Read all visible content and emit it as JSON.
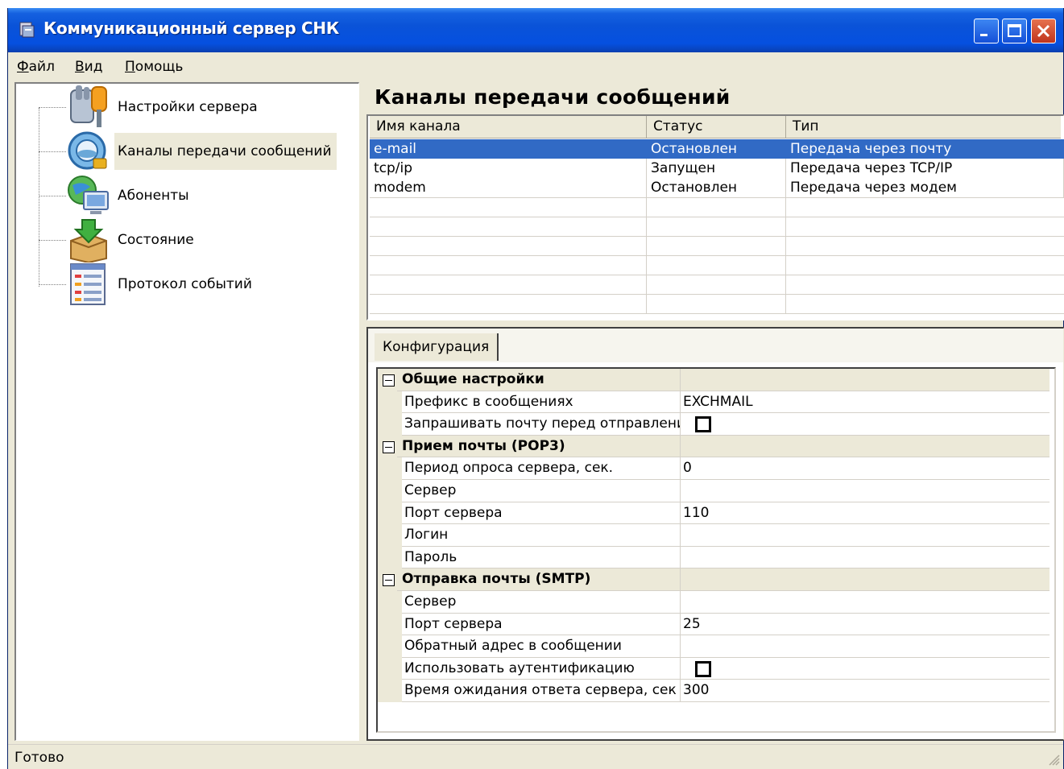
{
  "window": {
    "title": "Коммуникационный сервер СНК"
  },
  "menu": [
    {
      "label_u": "Ф",
      "label_rest": "айл"
    },
    {
      "label_u": "В",
      "label_rest": "ид"
    },
    {
      "label_u": "П",
      "label_rest": "омощь"
    }
  ],
  "tree": {
    "items": [
      {
        "label": "Настройки сервера",
        "icon": "tools-icon"
      },
      {
        "label": "Каналы передачи сообщений",
        "icon": "network-globe-icon"
      },
      {
        "label": "Абоненты",
        "icon": "users-globe-icon"
      },
      {
        "label": "Состояние",
        "icon": "box-arrow-icon"
      },
      {
        "label": "Протокол событий",
        "icon": "list-log-icon"
      }
    ],
    "selected_index": 1
  },
  "channels": {
    "title": "Каналы передачи сообщений",
    "columns": [
      "Имя канала",
      "Статус",
      "Тип"
    ],
    "rows": [
      [
        "e-mail",
        "Остановлен",
        "Передача через почту"
      ],
      [
        "tcp/ip",
        "Запущен",
        "Передача через TCP/IP"
      ],
      [
        "modem",
        "Остановлен",
        "Передача через модем"
      ]
    ],
    "selected_row": 0
  },
  "config": {
    "tab": "Конфигурация",
    "rows": [
      {
        "type": "cat",
        "name": "Общие настройки"
      },
      {
        "type": "prop",
        "name": "Префикс в сообщениях",
        "value": "EXCHMAIL"
      },
      {
        "type": "check",
        "name": "Запрашивать почту перед отправлени",
        "checked": false
      },
      {
        "type": "cat",
        "name": "Прием почты (POP3)"
      },
      {
        "type": "prop",
        "name": "Период опроса сервера, сек.",
        "value": "0"
      },
      {
        "type": "prop",
        "name": "Сервер",
        "value": ""
      },
      {
        "type": "prop",
        "name": "Порт сервера",
        "value": "110"
      },
      {
        "type": "prop",
        "name": "Логин",
        "value": ""
      },
      {
        "type": "prop",
        "name": "Пароль",
        "value": ""
      },
      {
        "type": "cat",
        "name": "Отправка почты (SMTP)"
      },
      {
        "type": "prop",
        "name": "Сервер",
        "value": ""
      },
      {
        "type": "prop",
        "name": "Порт сервера",
        "value": "25"
      },
      {
        "type": "prop",
        "name": "Обратный адрес в сообщении",
        "value": ""
      },
      {
        "type": "check",
        "name": "Использовать аутентификацию",
        "checked": false
      },
      {
        "type": "prop",
        "name": "Время ожидания ответа сервера, сек",
        "value": "300"
      }
    ]
  },
  "status": {
    "text": "Готово"
  }
}
